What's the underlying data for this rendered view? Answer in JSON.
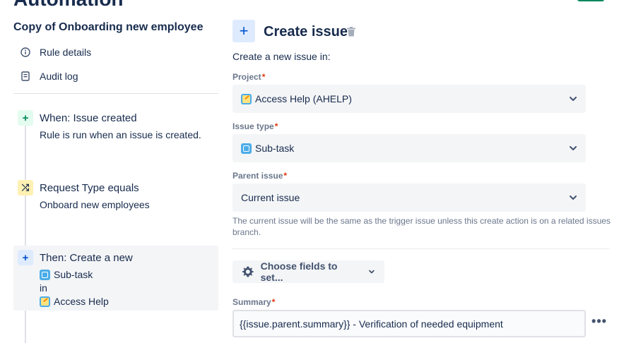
{
  "header": {
    "page_title": "Automation"
  },
  "sidebar": {
    "rule_name": "Copy of Onboarding new employee",
    "nav": [
      {
        "label": "Rule details",
        "icon": "info-icon"
      },
      {
        "label": "Audit log",
        "icon": "audit-log-icon"
      }
    ],
    "steps": [
      {
        "badge": "+",
        "title": "When: Issue created",
        "subtitle": "Rule is run when an issue is created."
      },
      {
        "badge": "⤮",
        "title": "Request Type equals",
        "subtitle": "Onboard new employees"
      },
      {
        "badge": "+",
        "title": "Then: Create a new",
        "issue_type": "Sub-task",
        "in_label": "in",
        "project": "Access Help"
      }
    ]
  },
  "action": {
    "badge": "+",
    "title": "Create issue",
    "create_in_label": "Create a new issue in:",
    "project_label": "Project",
    "project_value": "Access Help (AHELP)",
    "issue_type_label": "Issue type",
    "issue_type_value": "Sub-task",
    "parent_issue_label": "Parent issue",
    "parent_issue_value": "Current issue",
    "required_mark": "*",
    "helper_text": "The current issue will be the same as the trigger issue unless this create action is on a related issues branch.",
    "choose_fields_label": "Choose fields to set...",
    "summary_label": "Summary",
    "summary_value": "{{issue.parent.summary}} - Verification of needed equipment",
    "more_label": "•••"
  },
  "colors": {
    "accent": "#0052cc",
    "required": "#de350b",
    "trigger": "#00875a",
    "condition": "#fff0b3"
  }
}
